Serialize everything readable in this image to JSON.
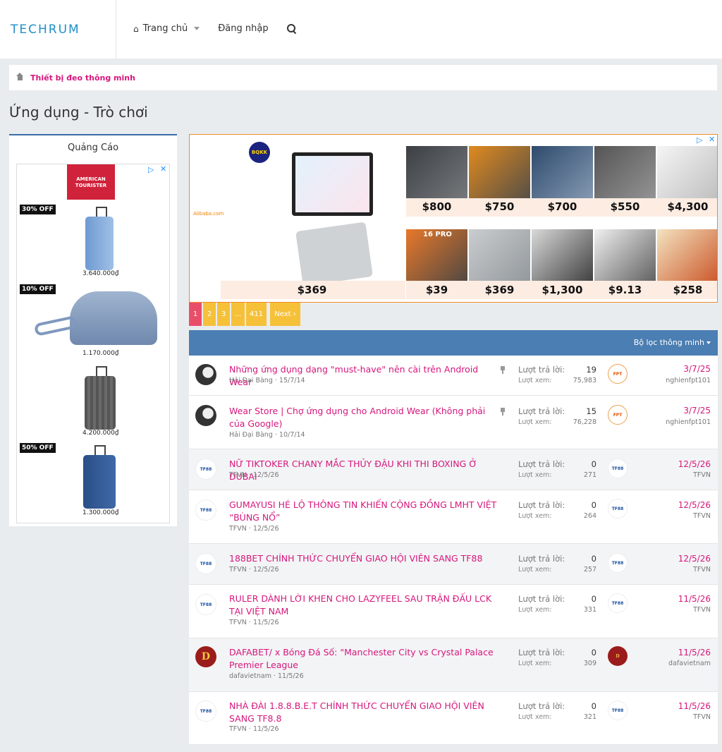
{
  "header": {
    "logo": "TECHRUM",
    "nav": [
      {
        "label": "Trang chủ"
      },
      {
        "label": "Đăng nhập"
      }
    ]
  },
  "breadcrumb": {
    "label": "Thiết bị đeo thông minh"
  },
  "page_title": "Ứng dụng - Trò chơi",
  "sidebar": {
    "title": "Quảng Cáo",
    "ad": {
      "brand": "AMERICAN TOURISTER",
      "items": [
        {
          "discount": "30% OFF",
          "price": "3.640.000₫"
        },
        {
          "discount": "10% OFF",
          "price": "1.170.000₫"
        },
        {
          "discount": "",
          "price": "4.200.000₫"
        },
        {
          "discount": "50% OFF",
          "price": "1.300.000₫"
        }
      ]
    }
  },
  "banner": {
    "brand": "BQKK",
    "seller": "Alibaba.com",
    "main_price": "$369",
    "row1": [
      "$800",
      "$750",
      "$700",
      "$550",
      "$4,300"
    ],
    "row2": [
      "$39",
      "$369",
      "$1,300",
      "$9.13",
      "$258"
    ],
    "tag_16pro": "16 PRO"
  },
  "pager": {
    "pages": [
      "1",
      "2",
      "3",
      "...",
      "411"
    ],
    "next": "Next ›"
  },
  "list": {
    "filter": "Bộ lọc thông minh",
    "reply_label": "Lượt trả lời:",
    "view_label": "Lượt xem:",
    "threads": [
      {
        "title": "Những ứng dụng dạng \"must-have\" nên cài trên Android Wear",
        "author": "Hải Đại Bàng",
        "date": "15/7/14",
        "replies": "19",
        "views": "75,983",
        "last_date": "3/7/25",
        "last_user": "nghienfpt101",
        "pinned": true
      },
      {
        "title": "Wear Store | Chợ ứng dụng cho Android Wear (Không phải của Google)",
        "author": "Hải Đại Bàng",
        "date": "10/7/14",
        "replies": "15",
        "views": "76,228",
        "last_date": "3/7/25",
        "last_user": "nghienfpt101",
        "pinned": true
      },
      {
        "title": "NỮ TIKTOKER CHANY MẮC THỦY ĐẬU KHI THI BOXING Ở DUBAI",
        "author": "TFVN",
        "date": "12/5/26",
        "replies": "0",
        "views": "271",
        "last_date": "12/5/26",
        "last_user": "TFVN"
      },
      {
        "title": "GUMAYUSI HÉ LỘ THÔNG TIN KHIẾN CỘNG ĐỒNG LMHT VIỆT “BÙNG NỔ”",
        "author": "TFVN",
        "date": "12/5/26",
        "replies": "0",
        "views": "264",
        "last_date": "12/5/26",
        "last_user": "TFVN"
      },
      {
        "title": "188BET CHÍNH THỨC CHUYỂN GIAO HỘI VIÊN SANG TF88",
        "author": "TFVN",
        "date": "12/5/26",
        "replies": "0",
        "views": "257",
        "last_date": "12/5/26",
        "last_user": "TFVN"
      },
      {
        "title": "RULER DÀNH LỜI KHEN CHO LAZYFEEL SAU TRẬN ĐẤU LCK TẠI VIỆT NAM",
        "author": "TFVN",
        "date": "11/5/26",
        "replies": "0",
        "views": "331",
        "last_date": "11/5/26",
        "last_user": "TFVN"
      },
      {
        "title": "DAFABET/ x Bóng Đá Số: \"Manchester City vs Crystal Palace Premier League",
        "author": "dafavietnam",
        "date": "11/5/26",
        "replies": "0",
        "views": "309",
        "last_date": "11/5/26",
        "last_user": "dafavietnam"
      },
      {
        "title": "NHÀ ĐÀI 1.8.8.B.E.T CHÍNH THỨC CHUYỂN GIAO HỘI VIÊN SANG TF8.8",
        "author": "TFVN",
        "date": "11/5/26",
        "replies": "0",
        "views": "321",
        "last_date": "11/5/26",
        "last_user": "TFVN"
      }
    ]
  },
  "colors": {
    "accent": "#d6177c",
    "header_bar": "#4b7eb2",
    "pager": "#f6c139",
    "pager_active": "#e94e69"
  }
}
